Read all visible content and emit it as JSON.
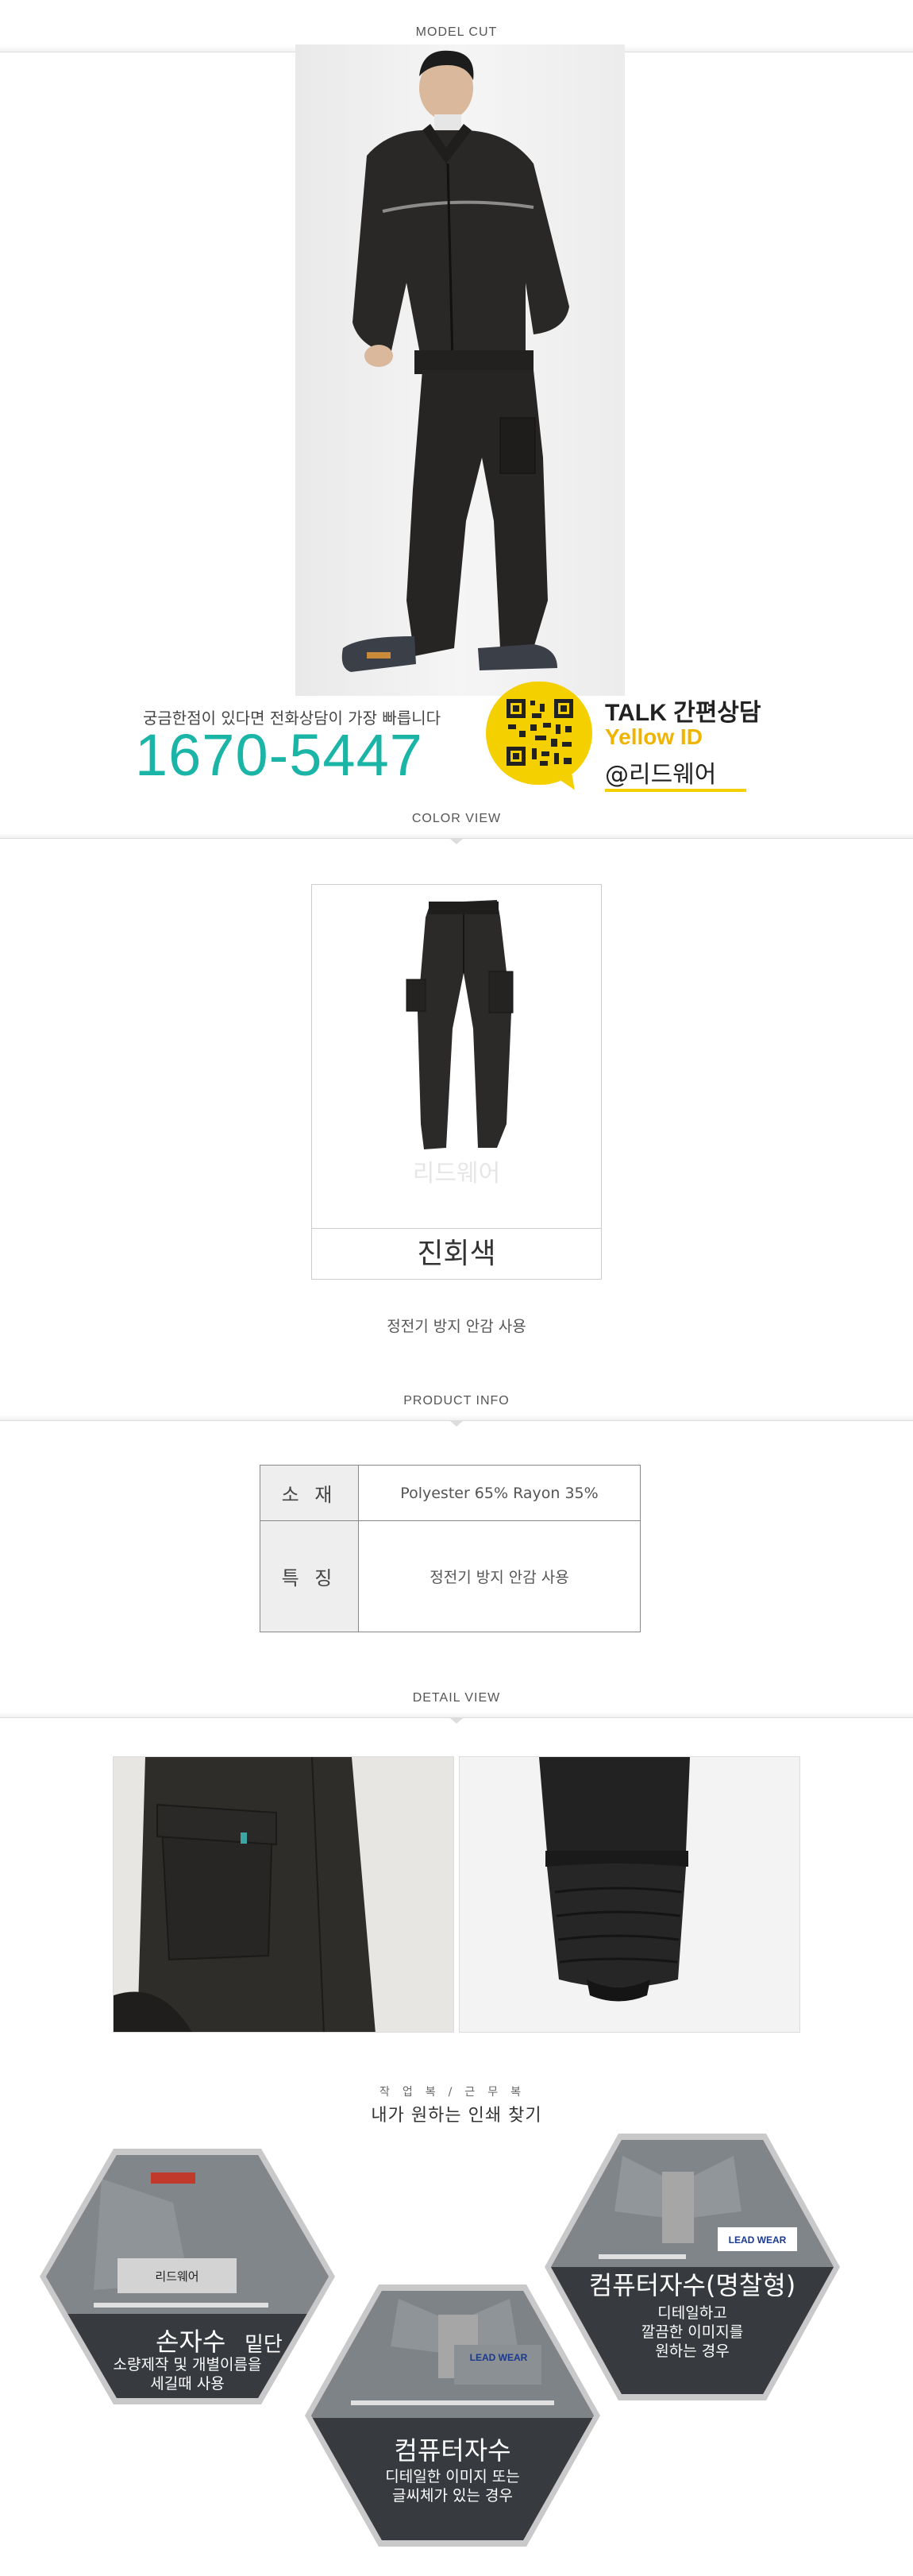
{
  "sections": {
    "model_cut": "MODEL CUT",
    "color_view": "COLOR VIEW",
    "product_info": "PRODUCT INFO",
    "detail_view": "DETAIL VIEW"
  },
  "contact": {
    "help_text": "궁금한점이 있다면 전화상담이 가장 빠릅니다",
    "phone": "1670-5447",
    "talk_prefix": "TALK",
    "talk_suffix": "간편상담",
    "yellow_id": "Yellow ID",
    "kakao_id": "@리드웨어"
  },
  "color_view": {
    "watermark": "리드웨어",
    "color_name": "진회색",
    "note": "정전기 방지 안감 사용"
  },
  "product_info": {
    "rows": [
      {
        "key": "소 재",
        "value": "Polyester 65% Rayon 35%"
      },
      {
        "key": "특 징",
        "value": "정전기 방지 안감 사용"
      }
    ]
  },
  "promo": {
    "subtitle": "작업복/근무복",
    "title": "내가 원하는 인쇄 찾기",
    "items": [
      {
        "title": "손자수",
        "desc": [
          "소량제작 및 개별이름을",
          "세길때 사용"
        ],
        "badge": "리드웨어",
        "overlay_word": "밑단"
      },
      {
        "title": "컴퓨터자수",
        "desc": [
          "디테일한 이미지 또는",
          "글씨체가 있는 경우"
        ],
        "badge": "LEAD WEAR"
      },
      {
        "title": "컴퓨터자수(명찰형)",
        "desc": [
          "디테일하고",
          "깔끔한 이미지를",
          "원하는 경우"
        ],
        "badge": "LEAD WEAR"
      }
    ]
  },
  "colors": {
    "accent_phone": "#1ab5a6",
    "kakao_yellow": "#f5d000",
    "jacket": "#2a2826"
  }
}
